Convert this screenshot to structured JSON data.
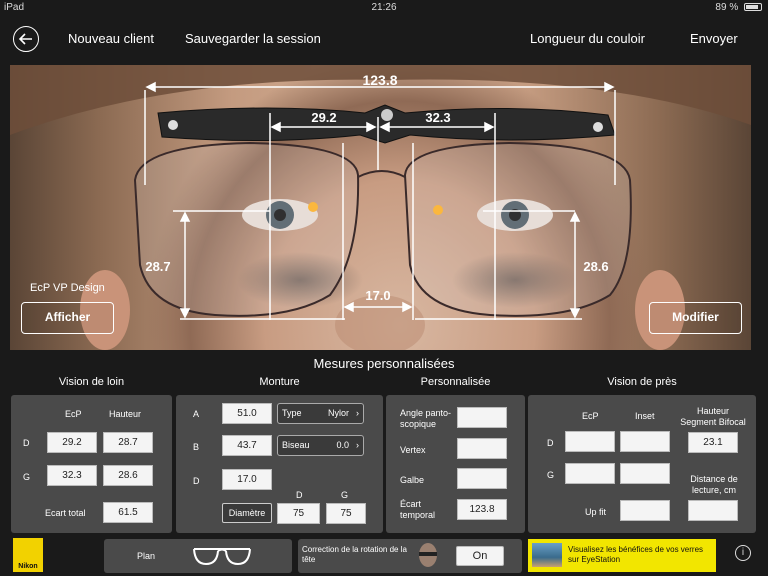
{
  "status": {
    "device": "iPad",
    "time": "21:26",
    "battery": "89 %",
    "battery_level": 0.89
  },
  "nav": {
    "new_client": "Nouveau client",
    "save_session": "Sauvegarder la session",
    "corridor_length": "Longueur du couloir",
    "send": "Envoyer"
  },
  "photo": {
    "total_width": "123.8",
    "left_half": "29.2",
    "right_half": "32.3",
    "left_height": "28.7",
    "right_height": "28.6",
    "bridge": "17.0",
    "ecp_design_label": "EcP VP Design",
    "show_button": "Afficher",
    "modify_button": "Modifier"
  },
  "section_title": "Mesures personnalisées",
  "far_vision": {
    "title": "Vision de loin",
    "col_ecp": "EcP",
    "col_height": "Hauteur",
    "row_d": "D",
    "row_g": "G",
    "d_ecp": "29.2",
    "d_height": "28.7",
    "g_ecp": "32.3",
    "g_height": "28.6",
    "total_label": "Ecart total",
    "total_value": "61.5"
  },
  "frame": {
    "title": "Monture",
    "a_label": "A",
    "a_value": "51.0",
    "b_label": "B",
    "b_value": "43.7",
    "d_label": "D",
    "d_value": "17.0",
    "type_label": "Type",
    "type_value": "Nylor",
    "bevel_label": "Biseau",
    "bevel_value": "0.0",
    "diameter_button": "Diamètre",
    "diam_col_d": "D",
    "diam_col_g": "G",
    "diam_d": "75",
    "diam_g": "75"
  },
  "custom": {
    "title": "Personnalisée",
    "pantoscopic": "Angle panto-scopique",
    "vertex": "Vertex",
    "wrap": "Galbe",
    "temporal_gap": "Écart temporal",
    "pantoscopic_value": "",
    "vertex_value": "",
    "wrap_value": "",
    "temporal_gap_value": "123.8"
  },
  "near_vision": {
    "title": "Vision de près",
    "col_ecp": "EcP",
    "col_inset": "Inset",
    "col_segment": "Hauteur Segment Bifocal",
    "row_d": "D",
    "row_g": "G",
    "segment_value": "23.1",
    "reading_distance": "Distance de lecture, cm",
    "up_fit": "Up fit"
  },
  "bottom": {
    "brand": "Nikon",
    "plan_label": "Plan",
    "head_rotation": "Correction de la rotation de la tête",
    "on_button": "On",
    "banner": "Visualisez les bénéfices de vos verres sur EyeStation",
    "info": "i"
  },
  "colors": {
    "panel": "#4a4a4a",
    "banner": "#f2e600",
    "brand": "#f2d200"
  }
}
